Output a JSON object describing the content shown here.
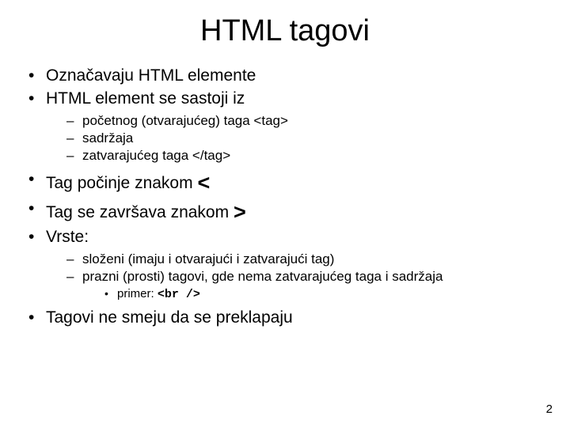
{
  "title": "HTML tagovi",
  "bullets": {
    "b1": "Označavaju HTML elemente",
    "b2": "HTML element se sastoji iz",
    "b2_sub": {
      "s1": "početnog (otvarajućeg) taga <tag>",
      "s2": "sadržaja",
      "s3": "zatvarajućeg taga </tag>"
    },
    "b3_pre": "Tag počinje znakom ",
    "b3_sym": "<",
    "b4_pre": "Tag se završava znakom ",
    "b4_sym": ">",
    "b5": "Vrste:",
    "b5_sub": {
      "s1": "složeni (imaju i otvarajući i zatvarajući tag)",
      "s2": "prazni (prosti) tagovi, gde nema zatvarajućeg taga i sadržaja",
      "s2_sub_pre": "primer: ",
      "s2_sub_code": "<br />"
    },
    "b6": "Tagovi ne smeju da se preklapaju"
  },
  "page_number": "2"
}
